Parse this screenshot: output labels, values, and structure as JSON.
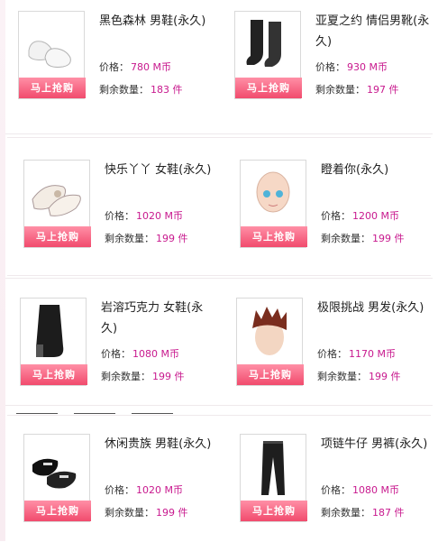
{
  "buy_label": "马上抢购",
  "price_label": "价格：",
  "stock_label": "剩余数量：",
  "items": [
    {
      "name": "黑色森林 男鞋(永久)",
      "price": "780 M币",
      "stock": "183 件",
      "icon": "white-shoes-icon"
    },
    {
      "name": "亚夏之约 情侣男靴(永久)",
      "price": "930 M币",
      "stock": "197 件",
      "icon": "black-boots-icon"
    },
    {
      "name": "快乐丫丫 女鞋(永久)",
      "price": "1020 M币",
      "stock": "199 件",
      "icon": "white-flats-icon"
    },
    {
      "name": "瞪着你(永久)",
      "price": "1200 M币",
      "stock": "199 件",
      "icon": "doll-face-icon"
    },
    {
      "name": "岩溶巧克力 女鞋(永久)",
      "price": "1080 M币",
      "stock": "199 件",
      "icon": "black-heel-boot-icon"
    },
    {
      "name": "极限挑战 男发(永久)",
      "price": "1170 M币",
      "stock": "199 件",
      "icon": "spiky-hair-icon"
    },
    {
      "name": "休闲贵族 男鞋(永久)",
      "price": "1020 M币",
      "stock": "199 件",
      "icon": "black-loafers-icon"
    },
    {
      "name": "项链牛仔 男裤(永久)",
      "price": "1080 M币",
      "stock": "187 件",
      "icon": "black-jeans-icon"
    }
  ]
}
